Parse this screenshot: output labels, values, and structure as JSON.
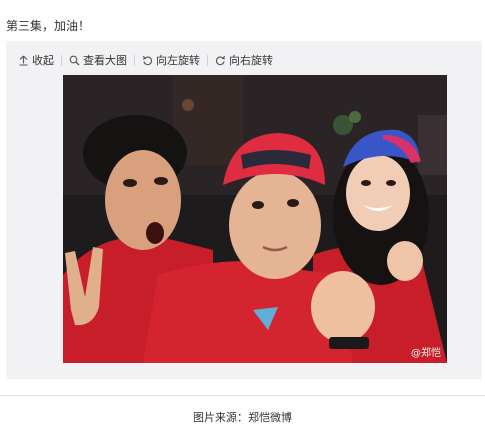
{
  "post": {
    "text": "第三集，加油！"
  },
  "toolbar": {
    "collapse_label": "收起",
    "view_large_label": "查看大图",
    "rotate_left_label": "向左旋转",
    "rotate_right_label": "向右旋转"
  },
  "photo": {
    "watermark": "@郑恺"
  },
  "caption": {
    "text": "图片来源：郑恺微博"
  }
}
